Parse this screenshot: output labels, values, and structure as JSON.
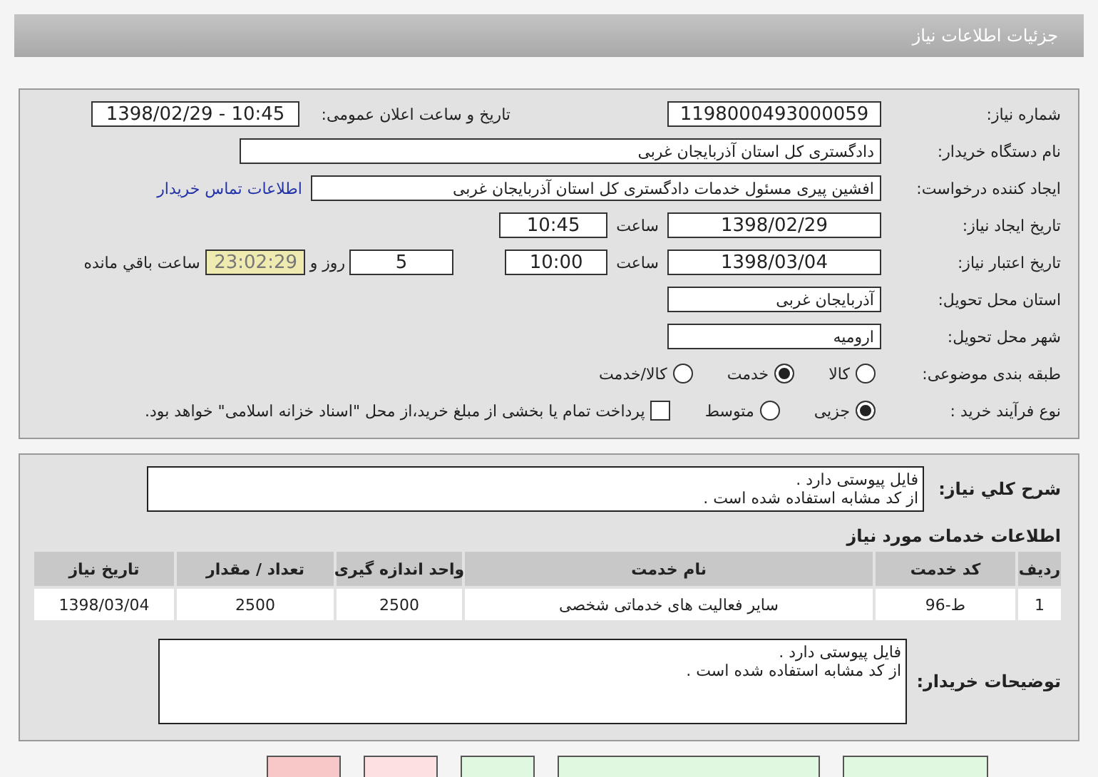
{
  "header": {
    "title": "جزئیات اطلاعات نیاز"
  },
  "need": {
    "number": {
      "label": "شماره نیاز:",
      "value": "1198000493000059"
    },
    "announce": {
      "label": "تاریخ و ساعت اعلان عمومی:",
      "value": "1398/02/29 - 10:45"
    },
    "buyer": {
      "label": "نام دستگاه خریدار:",
      "value": "دادگستری کل استان آذربایجان غربی"
    },
    "creator": {
      "label": "ایجاد کننده درخواست:",
      "value": "افشین پیری مسئول خدمات دادگستری کل استان آذربایجان غربی",
      "link": "اطلاعات تماس خریدار"
    },
    "created": {
      "label": "تاریخ ایجاد نیاز:",
      "date": "1398/02/29",
      "time_label": "ساعت",
      "time": "10:45"
    },
    "deadline": {
      "label": "تاریخ اعتبار نیاز:",
      "date": "1398/03/04",
      "time_label": "ساعت",
      "time": "10:00",
      "days": "5",
      "days_label": "روز و",
      "remaining": "23:02:29",
      "remaining_label": "ساعت باقي مانده"
    },
    "province": {
      "label": "استان محل تحویل:",
      "value": "آذربایجان غربی"
    },
    "city": {
      "label": "شهر محل تحویل:",
      "value": "ارومیه"
    },
    "category": {
      "label": "طبقه بندی موضوعی:",
      "options": [
        {
          "label": "کالا",
          "selected": false
        },
        {
          "label": "خدمت",
          "selected": true
        },
        {
          "label": "کالا/خدمت",
          "selected": false
        }
      ]
    },
    "process": {
      "label": "نوع فرآیند خرید :",
      "options": [
        {
          "label": "جزیی",
          "selected": true
        },
        {
          "label": "متوسط",
          "selected": false
        }
      ],
      "payment": {
        "checked": false,
        "text": "پرداخت تمام یا بخشی از مبلغ خرید،از محل \"اسناد خزانه اسلامی\" خواهد بود."
      }
    }
  },
  "description": {
    "label": "شرح کلي نیاز:",
    "lines": [
      "فایل پیوستی دارد .",
      "از کد مشابه استفاده شده است ."
    ]
  },
  "services": {
    "title": "اطلاعات خدمات مورد نیاز",
    "columns": [
      "ردیف",
      "کد خدمت",
      "نام خدمت",
      "واحد اندازه گیری",
      "تعداد / مقدار",
      "تاریخ نیاز"
    ],
    "rows": [
      [
        "1",
        "ط-96",
        "سایر فعالیت های خدماتی شخصی",
        "2500",
        "2500",
        "1398/03/04"
      ]
    ]
  },
  "buyer_notes": {
    "label": "توضیحات خریدار:",
    "lines": [
      "فایل پیوستی دارد .",
      "از کد مشابه استفاده شده است ."
    ]
  },
  "buttons": [
    {
      "kind": "green"
    },
    {
      "kind": "green"
    },
    {
      "kind": "green"
    },
    {
      "kind": "pink"
    },
    {
      "kind": "red"
    }
  ]
}
